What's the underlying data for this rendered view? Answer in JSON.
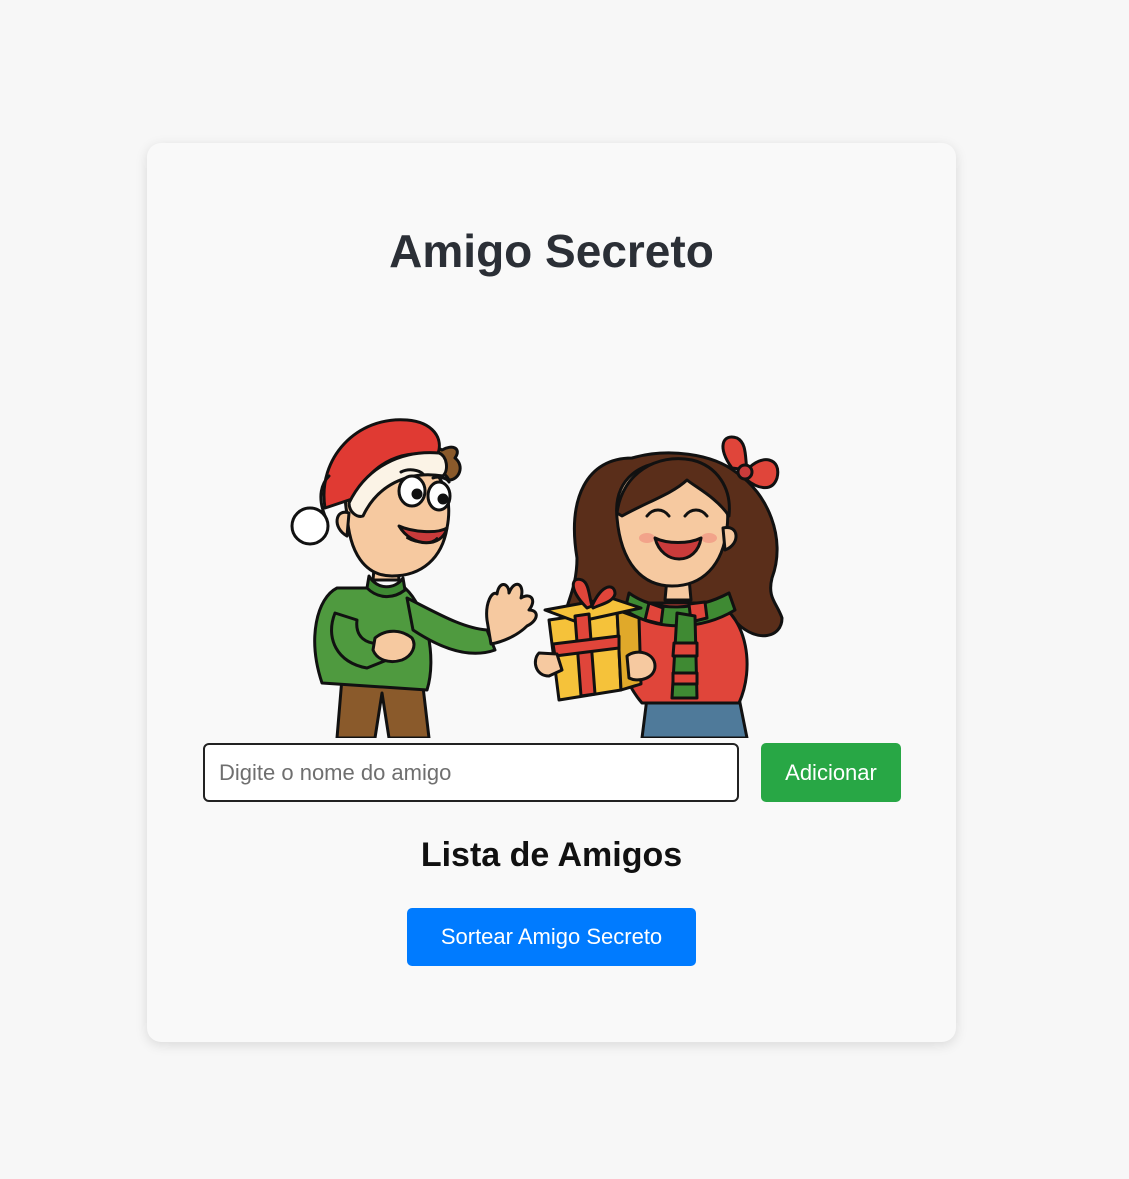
{
  "app": {
    "title": "Amigo Secreto"
  },
  "form": {
    "input_placeholder": "Digite o nome do amigo",
    "input_value": "",
    "add_button_label": "Adicionar"
  },
  "list": {
    "title": "Lista de Amigos",
    "items": []
  },
  "actions": {
    "draw_button_label": "Sortear Amigo Secreto"
  },
  "illustration": {
    "icon": "kids-exchanging-gift-illustration"
  },
  "colors": {
    "background": "#f7f7f7",
    "card": "#f9f9f9",
    "add_button": "#28a745",
    "draw_button": "#007bff",
    "title_text": "#2b2f36"
  }
}
